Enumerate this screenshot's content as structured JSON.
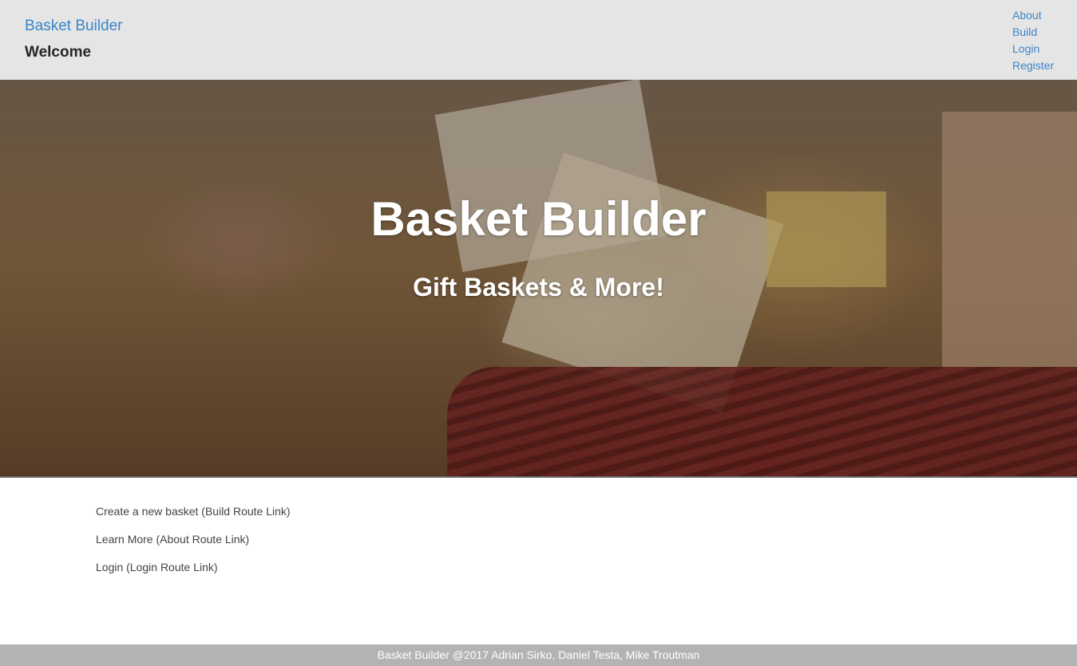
{
  "header": {
    "brand": "Basket Builder",
    "title": "Welcome",
    "nav": [
      "About",
      "Build",
      "Login",
      "Register"
    ]
  },
  "hero": {
    "title": "Basket Builder",
    "subtitle": "Gift Baskets & More!"
  },
  "links": [
    "Create a new basket (Build Route Link)",
    "Learn More (About Route Link)",
    "Login (Login Route Link)"
  ],
  "footer": {
    "text": "Basket Builder @2017 Adrian Sirko, Daniel Testa, Mike Troutman"
  },
  "colors": {
    "header_bg": "#e5e5e5",
    "link": "#3a85c9",
    "footer_bg": "#b3b3b3"
  }
}
